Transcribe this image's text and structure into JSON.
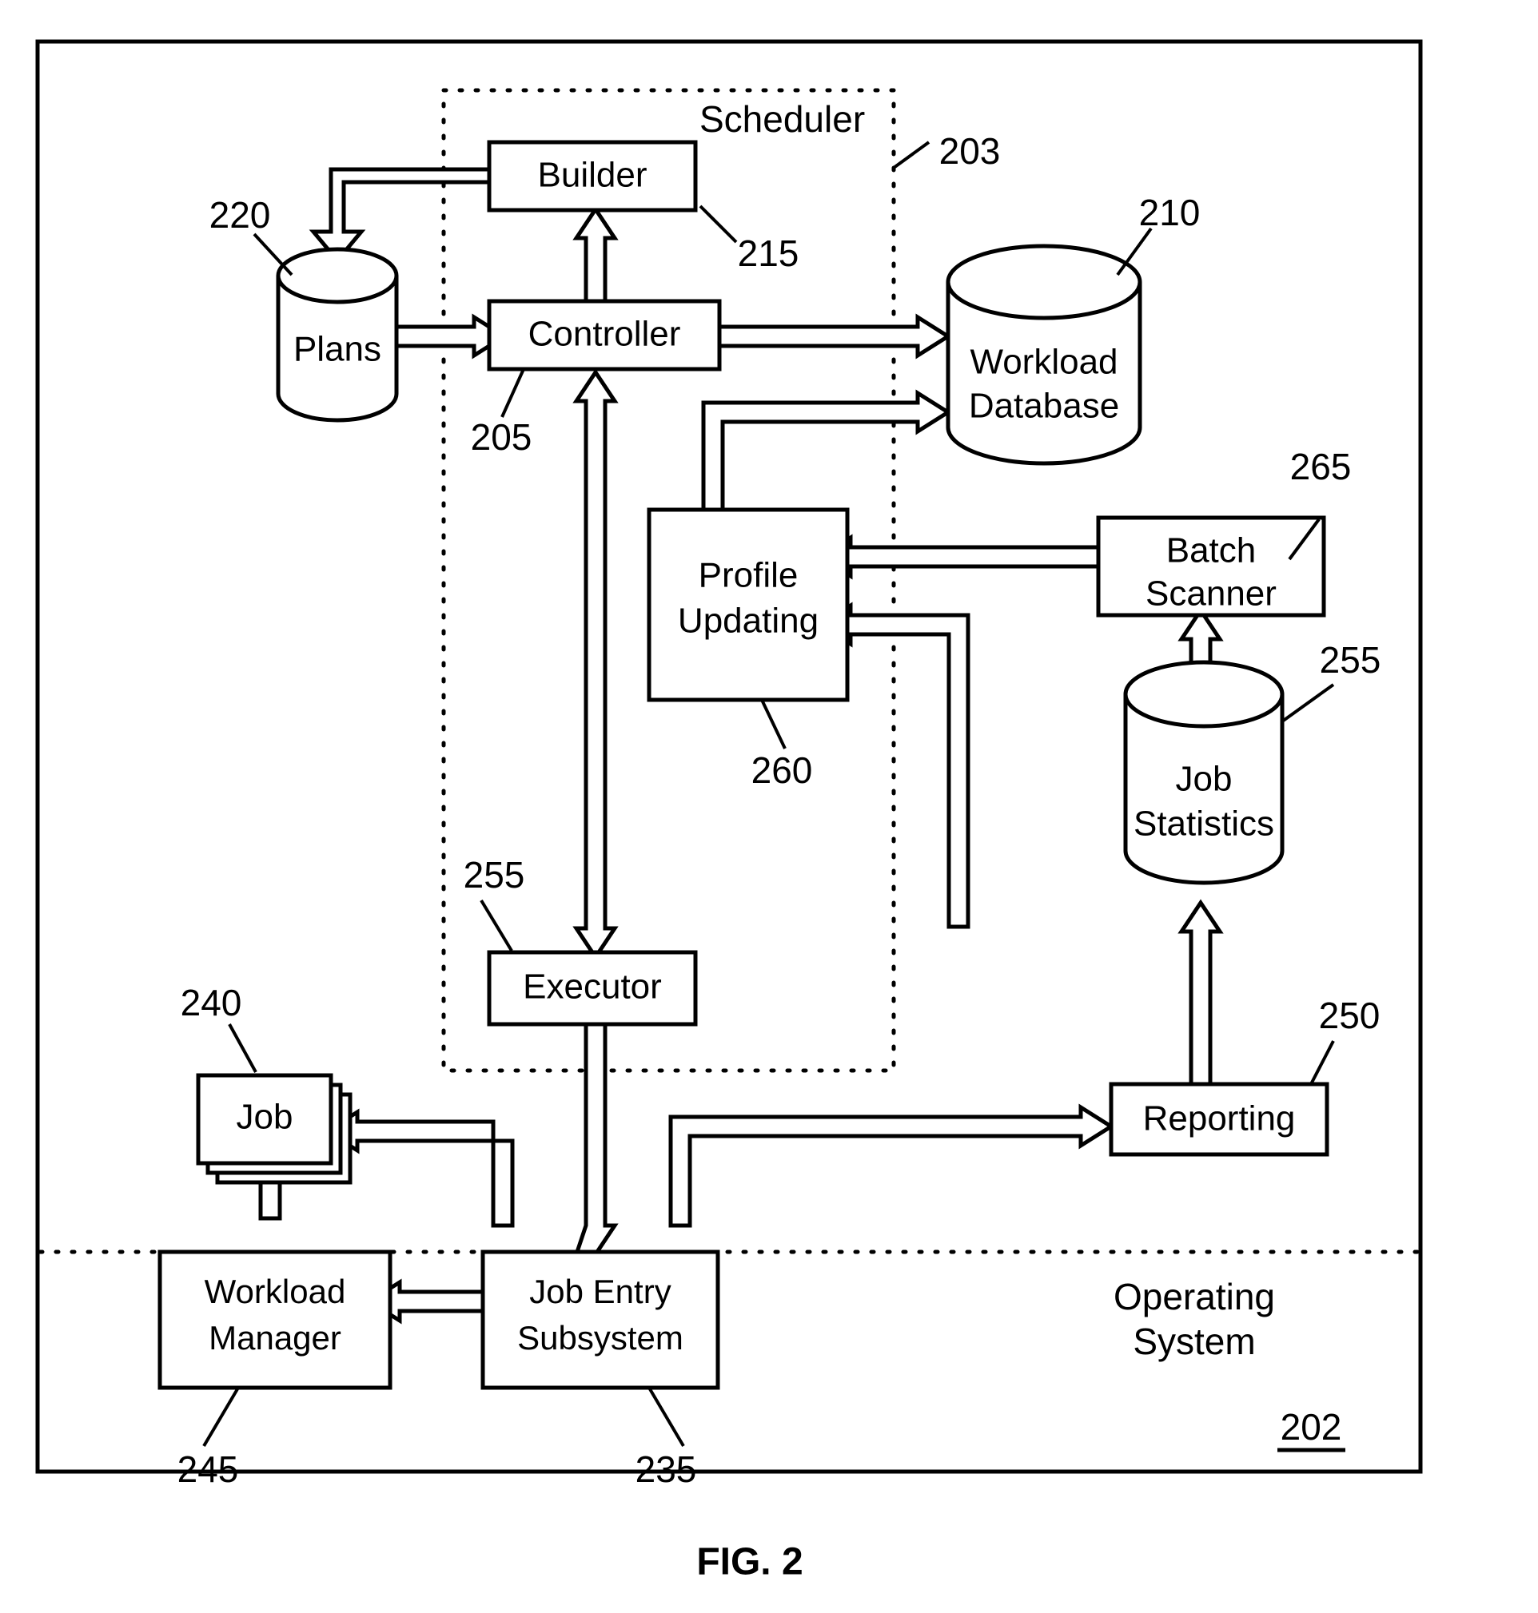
{
  "figure": {
    "caption": "FIG. 2",
    "outer_region_label": "Operating System",
    "outer_region_ref": "202",
    "scheduler_region_label": "Scheduler",
    "scheduler_region_ref": "203"
  },
  "nodes": {
    "builder": {
      "label": "Builder",
      "ref": "215"
    },
    "controller": {
      "label": "Controller",
      "ref": "205"
    },
    "plans": {
      "label": "Plans",
      "ref": "220"
    },
    "workload_database": {
      "label_line1": "Workload",
      "label_line2": "Database",
      "ref": "210"
    },
    "profile_updating": {
      "label_line1": "Profile",
      "label_line2": "Updating",
      "ref": "260"
    },
    "batch_scanner": {
      "label_line1": "Batch",
      "label_line2": "Scanner",
      "ref": "265"
    },
    "job_statistics": {
      "label_line1": "Job",
      "label_line2": "Statistics",
      "ref": "255"
    },
    "executor": {
      "label": "Executor",
      "ref": "255"
    },
    "job": {
      "label": "Job",
      "ref": "240"
    },
    "reporting": {
      "label": "Reporting",
      "ref": "250"
    },
    "workload_manager": {
      "label_line1": "Workload",
      "label_line2": "Manager",
      "ref": "245"
    },
    "job_entry_subsystem": {
      "label_line1": "Job Entry",
      "label_line2": "Subsystem",
      "ref": "235"
    }
  },
  "colors": {
    "stroke": "#000000",
    "fill": "#ffffff",
    "background": "#ffffff"
  }
}
